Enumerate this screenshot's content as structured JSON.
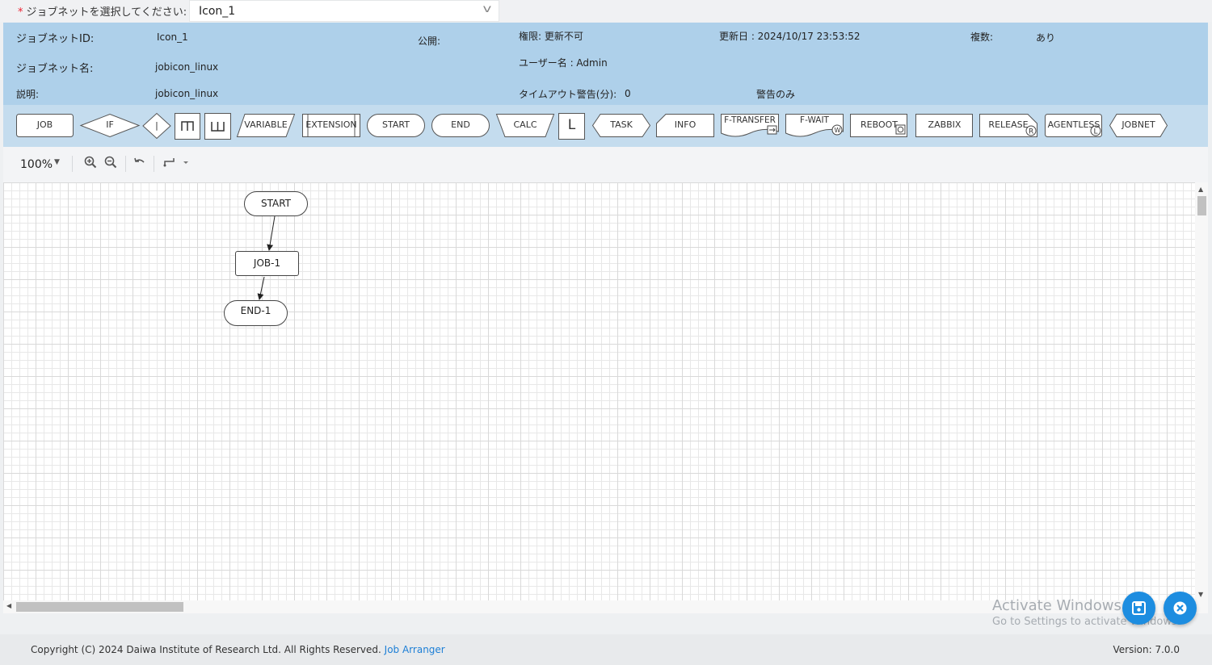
{
  "selector": {
    "label": "ジョブネットを選択してください:",
    "required_mark": "*",
    "value": "Icon_1"
  },
  "info": {
    "id_label": "ジョブネットID:",
    "id_value": "Icon_1",
    "public_label": "公開:",
    "permission": "権限: 更新不可",
    "updated": "更新日 : 2024/10/17 23:53:52",
    "multiple_label": "複数:",
    "multiple_value": "あり",
    "name_label": "ジョブネット名:",
    "name_value": "jobicon_linux",
    "user": "ユーザー名 : Admin",
    "desc_label": "説明:",
    "desc_value": "jobicon_linux",
    "timeout_label": "タイムアウト警告(分):",
    "timeout_value": "0",
    "warn_only": "警告のみ"
  },
  "palette": {
    "job": "JOB",
    "if": "IF",
    "parallel": "|",
    "variable": "VARIABLE",
    "extension": "EXTENSION",
    "start": "START",
    "end": "END",
    "calc": "CALC",
    "loop": "L",
    "task": "TASK",
    "info": "INFO",
    "ftransfer": "F-TRANSFER",
    "fwait": "F-WAIT",
    "reboot": "REBOOT",
    "zabbix": "ZABBIX",
    "release": "RELEASE",
    "agentless": "AGENTLESS",
    "jobnet": "JOBNET"
  },
  "zoom": {
    "level": "100%"
  },
  "diagram": {
    "nodes": {
      "start": "START",
      "job1": "JOB-1",
      "end1": "END-1"
    }
  },
  "watermark": {
    "title": "Activate Windows",
    "subtitle": "Go to Settings to activate Windows."
  },
  "footer": {
    "copyright": "Copyright (C) 2024 Daiwa Institute of Research Ltd. All Rights Reserved.",
    "link": "Job Arranger",
    "version": "Version: 7.0.0"
  },
  "colors": {
    "info_panel": "#aed0ea",
    "palette_bar": "#c4dcee",
    "fab": "#1d8de0",
    "required": "#e22233",
    "link": "#1d7fd6"
  }
}
